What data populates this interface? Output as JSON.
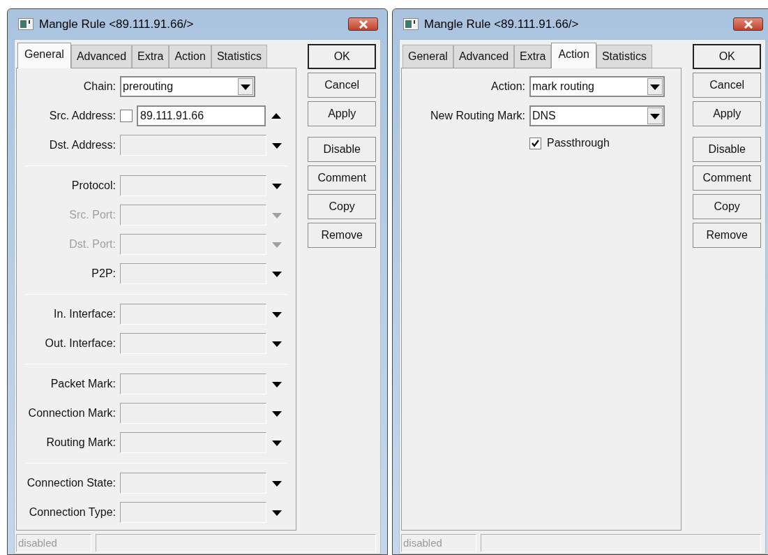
{
  "windows": [
    {
      "title": "Mangle Rule <89.111.91.66/>",
      "tabs": [
        {
          "label": "General",
          "selected": true
        },
        {
          "label": "Advanced",
          "selected": false
        },
        {
          "label": "Extra",
          "selected": false
        },
        {
          "label": "Action",
          "selected": false
        },
        {
          "label": "Statistics",
          "selected": false
        }
      ],
      "sections": [
        [
          {
            "kind": "select",
            "label": "Chain:",
            "value": "prerouting"
          },
          {
            "kind": "address",
            "label": "Src. Address:",
            "negated": false,
            "value": "89.111.91.66",
            "expanded": true
          },
          {
            "kind": "empty",
            "label": "Dst. Address:",
            "disabled": false
          }
        ],
        [
          {
            "kind": "empty",
            "label": "Protocol:",
            "disabled": false
          },
          {
            "kind": "empty",
            "label": "Src. Port:",
            "disabled": true
          },
          {
            "kind": "empty",
            "label": "Dst. Port:",
            "disabled": true
          },
          {
            "kind": "empty",
            "label": "P2P:",
            "disabled": false
          }
        ],
        [
          {
            "kind": "empty",
            "label": "In. Interface:",
            "disabled": false
          },
          {
            "kind": "empty",
            "label": "Out. Interface:",
            "disabled": false
          }
        ],
        [
          {
            "kind": "empty",
            "label": "Packet Mark:",
            "disabled": false
          },
          {
            "kind": "empty",
            "label": "Connection Mark:",
            "disabled": false
          },
          {
            "kind": "empty",
            "label": "Routing Mark:",
            "disabled": false
          }
        ],
        [
          {
            "kind": "empty",
            "label": "Connection State:",
            "disabled": false
          },
          {
            "kind": "empty",
            "label": "Connection Type:",
            "disabled": false
          }
        ]
      ],
      "buttons": [
        [
          {
            "label": "OK",
            "default": true
          },
          {
            "label": "Cancel",
            "default": false
          },
          {
            "label": "Apply",
            "default": false
          }
        ],
        [
          {
            "label": "Disable",
            "default": false
          },
          {
            "label": "Comment",
            "default": false
          },
          {
            "label": "Copy",
            "default": false
          },
          {
            "label": "Remove",
            "default": false
          }
        ]
      ],
      "status_bar": {
        "state": "disabled"
      }
    },
    {
      "title": "Mangle Rule <89.111.91.66/>",
      "tabs": [
        {
          "label": "General",
          "selected": false
        },
        {
          "label": "Advanced",
          "selected": false
        },
        {
          "label": "Extra",
          "selected": false
        },
        {
          "label": "Action",
          "selected": true
        },
        {
          "label": "Statistics",
          "selected": false
        }
      ],
      "sections": [
        [
          {
            "kind": "select",
            "label": "Action:",
            "value": "mark routing"
          },
          {
            "kind": "select",
            "label": "New Routing Mark:",
            "value": "DNS"
          },
          {
            "kind": "checkbox",
            "label": "Passthrough",
            "checked": true
          }
        ]
      ],
      "buttons": [
        [
          {
            "label": "OK",
            "default": true
          },
          {
            "label": "Cancel",
            "default": false
          },
          {
            "label": "Apply",
            "default": false
          }
        ],
        [
          {
            "label": "Disable",
            "default": false
          },
          {
            "label": "Comment",
            "default": false
          },
          {
            "label": "Copy",
            "default": false
          },
          {
            "label": "Remove",
            "default": false
          }
        ]
      ],
      "status_bar": {
        "state": "disabled"
      }
    }
  ]
}
